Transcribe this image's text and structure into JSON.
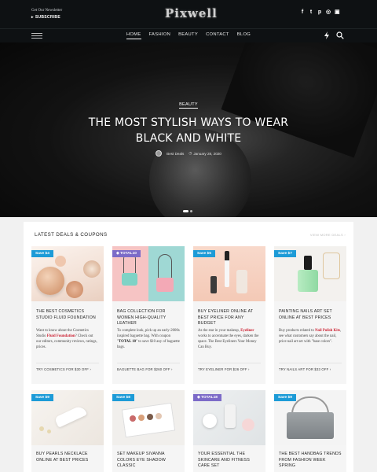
{
  "header": {
    "newsletter_line": "Get Our Newsletter",
    "subscribe_label": "SUBSCRIBE",
    "logo_text": "Pixwell",
    "social_icons": [
      "facebook-icon",
      "twitter-icon",
      "pinterest-icon",
      "instagram-icon",
      "flipboard-icon"
    ],
    "social_glyphs": [
      "f",
      "t",
      "p",
      "◎",
      "▣"
    ]
  },
  "nav": {
    "items": [
      {
        "label": "HOME",
        "active": true
      },
      {
        "label": "FASHION",
        "active": false
      },
      {
        "label": "BEAUTY",
        "active": false
      },
      {
        "label": "CONTACT",
        "active": false
      },
      {
        "label": "BLOG",
        "active": false
      }
    ]
  },
  "hero": {
    "category": "BEAUTY",
    "title": "THE MOST STYLISH WAYS TO WEAR BLACK AND WHITE",
    "author": "Best Deals",
    "date": "January 28, 2020"
  },
  "deals": {
    "section_title": "LATEST DEALS & COUPONS",
    "view_all": "VIEW MORE DEALS",
    "cards": [
      {
        "badge": "Save $4",
        "badge_color": "#1d9bd7",
        "title": "THE BEST COSMETICS STUDIO FLUID FOUNDATION",
        "desc_before": "Want to know about the Cosmetics Studio ",
        "desc_highlight": "Fluid Foundation",
        "desc_after": "? Check out our editors, community reviews, ratings, prices.",
        "link": "TRY COSMETICS FOR $30 OFF"
      },
      {
        "badge": "TOTAL10",
        "badge_color": "#7c6bc8",
        "title": "BAG COLLECTION FOR WOMEN HIGH-QUALITY LEATHER",
        "desc_before": "To complete look, pick up an early-2000s inspired baguette bag. With coupon \"",
        "desc_highlight": "TOTAL 10",
        "desc_after": "\" to save $10 any of baguette bags.",
        "link": "BAGUETTE BAG FOR $260 OFF"
      },
      {
        "badge": "Save $5",
        "badge_color": "#1d9bd7",
        "title": "BUY EYELINER ONLINE AT BEST PRICE FOR ANY BUDGET",
        "desc_before": "As the star in your makeup, ",
        "desc_highlight": "Eyeliner",
        "desc_after": " works to accentuate the eyes, darken the space. The Best Eyeliners Your Money Can Buy.",
        "link": "TRY EYELINER FOR $26 OFF"
      },
      {
        "badge": "Save $7",
        "badge_color": "#1d9bd7",
        "title": "PAINTING NAILS ART SET ONLINE AT BEST PRICES",
        "desc_before": "Buy products related to ",
        "desc_highlight": "Nail Polish Kits",
        "desc_after": ", see what customers say about the nail, price nail art set with \"base colors\".",
        "link": "TRY NAILS ART FOR $33 OFF"
      }
    ],
    "cards_row2": [
      {
        "badge": "Save $9",
        "badge_color": "#1d9bd7",
        "title": "BUY PEARLS NECKLACE ONLINE AT BEST PRICES"
      },
      {
        "badge": "Save $8",
        "badge_color": "#1d9bd7",
        "title": "SET MAKEUP SIVANNA COLORS EYE SHADOW CLASSIC"
      },
      {
        "badge": "TOTAL18",
        "badge_color": "#7c6bc8",
        "title": "YOUR ESSENTIAL THE SKINCARE AND FITNESS CARE SET"
      },
      {
        "badge": "Save $9",
        "badge_color": "#1d9bd7",
        "title": "THE BEST HANDBAG TRENDS FROM FASHION WEEK SPRING"
      }
    ]
  }
}
